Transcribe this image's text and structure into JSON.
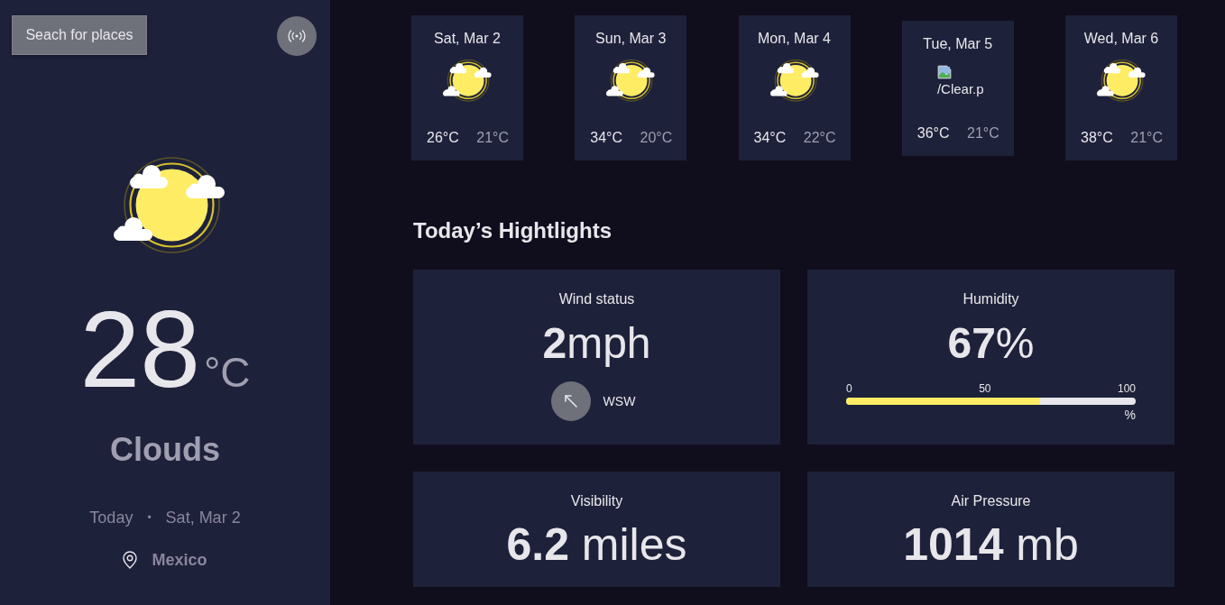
{
  "sidebar": {
    "search_button": "Seach for places",
    "temperature": "28",
    "unit": "°C",
    "condition": "Clouds",
    "day": "Today",
    "separator": "•",
    "date": "Sat, Mar 2",
    "location": "Mexico"
  },
  "forecast": [
    {
      "date": "Sat, Mar 2",
      "kind": "clouds",
      "max": "26°C",
      "min": "21°C"
    },
    {
      "date": "Sun, Mar 3",
      "kind": "clouds",
      "max": "34°C",
      "min": "20°C"
    },
    {
      "date": "Mon, Mar 4",
      "kind": "clouds",
      "max": "34°C",
      "min": "22°C"
    },
    {
      "date": "Tue, Mar 5",
      "kind": "broken-image",
      "alt": "/Clear.p",
      "max": "36°C",
      "min": "21°C"
    },
    {
      "date": "Wed, Mar 6",
      "kind": "clouds",
      "max": "38°C",
      "min": "21°C"
    }
  ],
  "highlights": {
    "title": "Today’s Hightlights",
    "items": [
      {
        "kind": "wind",
        "title": "Wind status",
        "value": "**2**mph",
        "direction": "WSW"
      },
      {
        "kind": "humidity",
        "title": "Humidity",
        "value": "**67**%",
        "scale": [
          "0",
          "50",
          "100"
        ],
        "level": 0.67,
        "scale_unit": "%"
      },
      {
        "kind": "plain",
        "title": "Visibility",
        "value": "**6.2** miles"
      },
      {
        "kind": "plain",
        "title": "Air Pressure",
        "value": "**1014** mb"
      }
    ]
  }
}
